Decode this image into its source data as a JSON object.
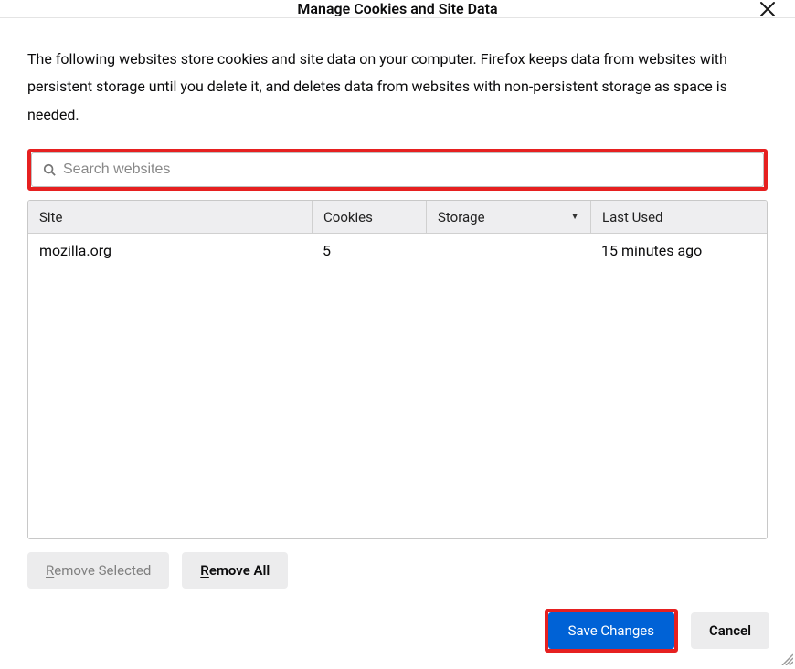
{
  "dialog": {
    "title": "Manage Cookies and Site Data",
    "description": "The following websites store cookies and site data on your computer. Firefox keeps data from websites with persistent storage until you delete it, and deletes data from websites with non-persistent storage as space is needed."
  },
  "search": {
    "placeholder": "Search websites"
  },
  "columns": {
    "site": "Site",
    "cookies": "Cookies",
    "storage": "Storage",
    "last_used": "Last Used",
    "sort_indicator": "▼"
  },
  "rows": [
    {
      "site": "mozilla.org",
      "cookies": "5",
      "storage": "",
      "last_used": "15 minutes ago"
    }
  ],
  "buttons": {
    "remove_selected_prefix": "R",
    "remove_selected_rest": "emove Selected",
    "remove_all_prefix": "R",
    "remove_all_rest": "emove All",
    "save_changes": "Save Changes",
    "cancel": "Cancel"
  }
}
